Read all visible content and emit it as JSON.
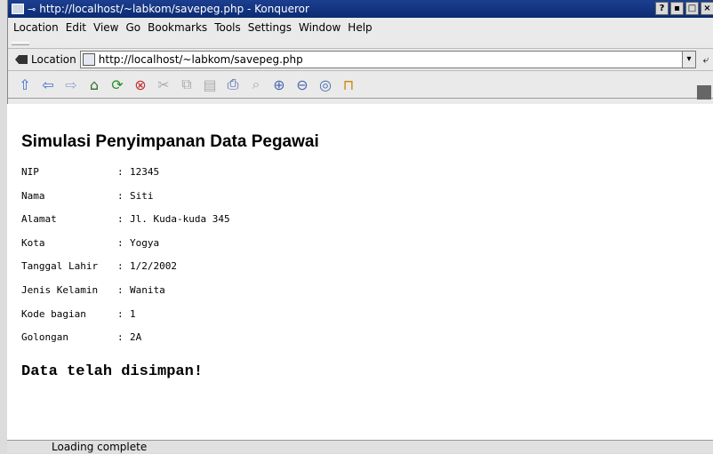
{
  "window": {
    "title": "http://localhost/~labkom/savepeg.php - Konqueror",
    "pin_glyph": "⊸",
    "buttons": [
      "?",
      "▪",
      "□",
      "×"
    ]
  },
  "menu": [
    "Location",
    "Edit",
    "View",
    "Go",
    "Bookmarks",
    "Tools",
    "Settings",
    "Window",
    "Help"
  ],
  "location": {
    "label": "Location",
    "url": "http://localhost/~labkom/savepeg.php",
    "drop_glyph": "▾",
    "go_glyph": "⤶"
  },
  "toolbar_icons": [
    "up-icon",
    "back-icon",
    "forward-icon",
    "home-icon",
    "reload-icon",
    "stop-icon",
    "cut-icon",
    "copy-icon",
    "paste-icon",
    "print-icon",
    "find-icon",
    "zoom-in-icon",
    "zoom-out-icon",
    "zoom-icon",
    "lock-icon"
  ],
  "page": {
    "heading": "Simulasi Penyimpanan Data Pegawai",
    "fields": [
      {
        "label": "NIP",
        "value": "12345"
      },
      {
        "label": "Nama",
        "value": "Siti"
      },
      {
        "label": "Alamat",
        "value": "Jl. Kuda-kuda 345"
      },
      {
        "label": "Kota",
        "value": "Yogya"
      },
      {
        "label": "Tanggal Lahir",
        "value": "1/2/2002"
      },
      {
        "label": "Jenis Kelamin",
        "value": "Wanita"
      },
      {
        "label": "Kode bagian",
        "value": "1"
      },
      {
        "label": "Golongan",
        "value": "2A"
      }
    ],
    "separator": ":",
    "message": "Data telah disimpan!"
  },
  "status": "Loading complete"
}
